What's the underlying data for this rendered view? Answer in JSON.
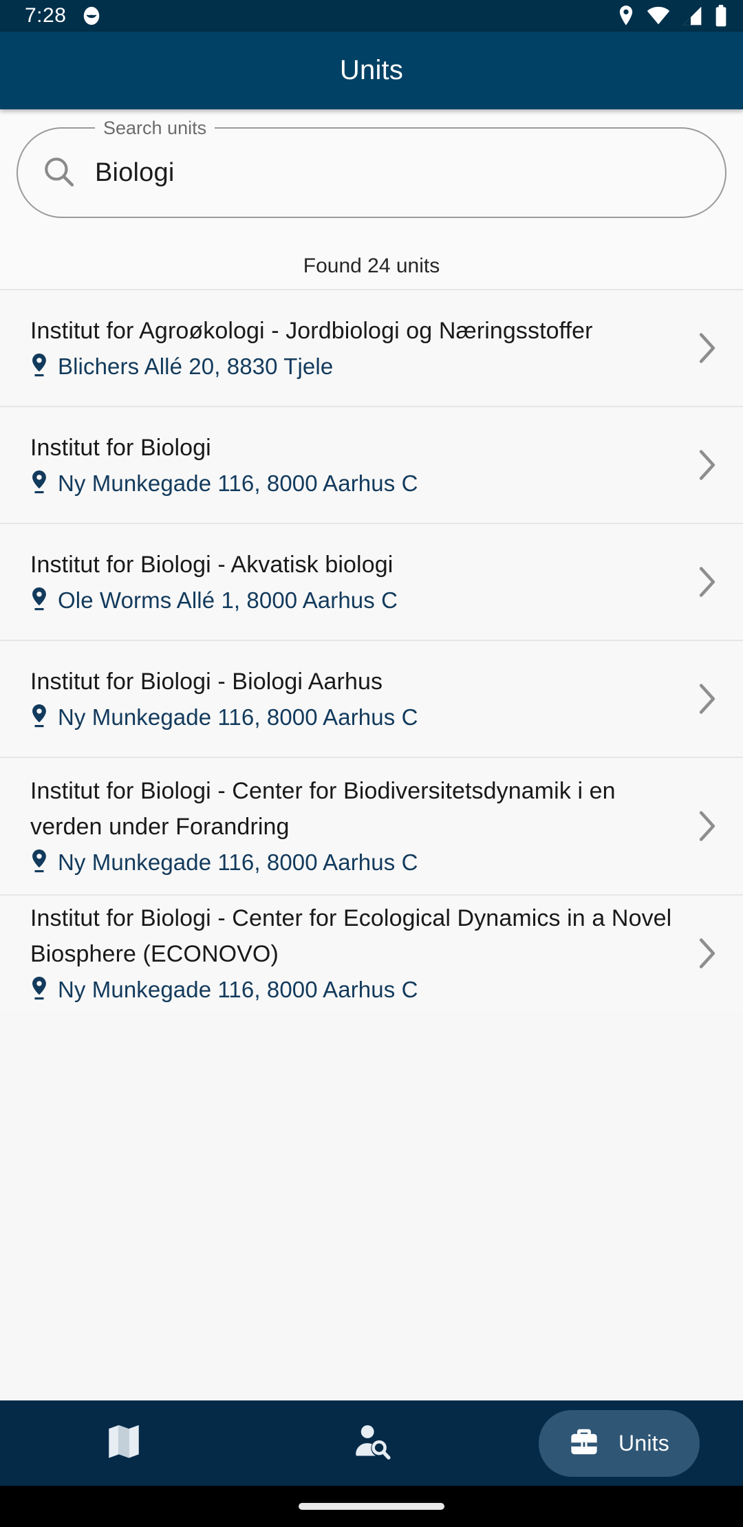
{
  "status_bar": {
    "time": "7:28",
    "icons": [
      "app-notification-icon",
      "location-pin-icon",
      "wifi-icon",
      "cellular-signal-icon",
      "battery-icon"
    ],
    "background_color": "#00304a"
  },
  "app_bar": {
    "title": "Units",
    "background_color": "#004165",
    "title_color": "#ffffff"
  },
  "search": {
    "legend": "Search units",
    "value": "Biologi",
    "placeholder": "Search units",
    "icon": "search-icon"
  },
  "results": {
    "count_text": "Found 24 units",
    "items": [
      {
        "title": "Institut for Agroøkologi - Jordbiologi og Næringsstoffer",
        "address": "Blichers Allé 20, 8830 Tjele",
        "lines": 2
      },
      {
        "title": "Institut for Biologi",
        "address": "Ny Munkegade 116, 8000 Aarhus C",
        "lines": 1
      },
      {
        "title": "Institut for Biologi - Akvatisk biologi",
        "address": "Ole Worms Allé 1, 8000 Aarhus C",
        "lines": 1
      },
      {
        "title": "Institut for Biologi - Biologi Aarhus",
        "address": "Ny Munkegade 116, 8000 Aarhus C",
        "lines": 1
      },
      {
        "title": "Institut for Biologi - Center for Biodiversitetsdynamik i en verden under Forandring",
        "address": "Ny Munkegade 116, 8000 Aarhus C",
        "lines": 3
      },
      {
        "title": "Institut for Biologi - Center for Ecological Dynamics in a Novel Biosphere (ECONOVO)",
        "address": "Ny Munkegade 116, 8000 Aarhus C",
        "lines": 2
      }
    ],
    "chevron_icon": "chevron-right-icon",
    "address_icon": "location-pin-icon",
    "address_color": "#123a5c"
  },
  "bottom_nav": {
    "background_color": "#042a48",
    "active_pill_color": "#2f5675",
    "items": [
      {
        "label": "",
        "icon": "map-icon",
        "active": false
      },
      {
        "label": "",
        "icon": "person-search-icon",
        "active": false
      },
      {
        "label": "Units",
        "icon": "briefcase-icon",
        "active": true
      }
    ]
  }
}
